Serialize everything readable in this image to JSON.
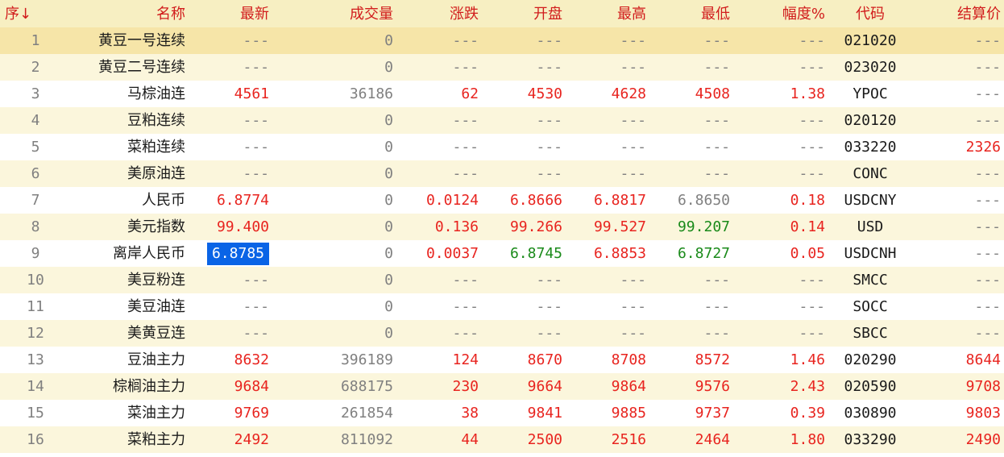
{
  "header": {
    "seq": "序",
    "seq_sort_icon": "arrow-down-icon",
    "sort_arrow": "↓",
    "name": "名称",
    "latest": "最新",
    "volume": "成交量",
    "change": "涨跌",
    "open": "开盘",
    "high": "最高",
    "low": "最低",
    "amplitude": "幅度%",
    "code": "代码",
    "settle": "结算价"
  },
  "colors": {
    "header_text": "#d11c1c",
    "up": "#e8241f",
    "down": "#1a8a1a",
    "neutral": "#808080",
    "selection": "#0a64e6"
  },
  "rows": [
    {
      "seq": "1",
      "name": "黄豆一号连续",
      "latest": "---",
      "volume": "0",
      "change": "---",
      "open": "---",
      "high": "---",
      "low": "---",
      "amplitude": "---",
      "code": "021020",
      "settle": "---"
    },
    {
      "seq": "2",
      "name": "黄豆二号连续",
      "latest": "---",
      "volume": "0",
      "change": "---",
      "open": "---",
      "high": "---",
      "low": "---",
      "amplitude": "---",
      "code": "023020",
      "settle": "---"
    },
    {
      "seq": "3",
      "name": "马棕油连",
      "latest": "4561",
      "volume": "36186",
      "change": "62",
      "open": "4530",
      "high": "4628",
      "low": "4508",
      "amplitude": "1.38",
      "code": "YPOC",
      "settle": "---"
    },
    {
      "seq": "4",
      "name": "豆粕连续",
      "latest": "---",
      "volume": "0",
      "change": "---",
      "open": "---",
      "high": "---",
      "low": "---",
      "amplitude": "---",
      "code": "020120",
      "settle": "---"
    },
    {
      "seq": "5",
      "name": "菜粕连续",
      "latest": "---",
      "volume": "0",
      "change": "---",
      "open": "---",
      "high": "---",
      "low": "---",
      "amplitude": "---",
      "code": "033220",
      "settle": "2326"
    },
    {
      "seq": "6",
      "name": "美原油连",
      "latest": "---",
      "volume": "0",
      "change": "---",
      "open": "---",
      "high": "---",
      "low": "---",
      "amplitude": "---",
      "code": "CONC",
      "settle": "---"
    },
    {
      "seq": "7",
      "name": "人民币",
      "latest": "6.8774",
      "volume": "0",
      "change": "0.0124",
      "open": "6.8666",
      "high": "6.8817",
      "low": "6.8650",
      "amplitude": "0.18",
      "code": "USDCNY",
      "settle": "---"
    },
    {
      "seq": "8",
      "name": "美元指数",
      "latest": "99.400",
      "volume": "0",
      "change": "0.136",
      "open": "99.266",
      "high": "99.527",
      "low": "99.207",
      "amplitude": "0.14",
      "code": "USD",
      "settle": "---"
    },
    {
      "seq": "9",
      "name": "离岸人民币",
      "latest": "6.8785",
      "volume": "0",
      "change": "0.0037",
      "open": "6.8745",
      "high": "6.8853",
      "low": "6.8727",
      "amplitude": "0.05",
      "code": "USDCNH",
      "settle": "---"
    },
    {
      "seq": "10",
      "name": "美豆粉连",
      "latest": "---",
      "volume": "0",
      "change": "---",
      "open": "---",
      "high": "---",
      "low": "---",
      "amplitude": "---",
      "code": "SMCC",
      "settle": "---"
    },
    {
      "seq": "11",
      "name": "美豆油连",
      "latest": "---",
      "volume": "0",
      "change": "---",
      "open": "---",
      "high": "---",
      "low": "---",
      "amplitude": "---",
      "code": "SOCC",
      "settle": "---"
    },
    {
      "seq": "12",
      "name": "美黄豆连",
      "latest": "---",
      "volume": "0",
      "change": "---",
      "open": "---",
      "high": "---",
      "low": "---",
      "amplitude": "---",
      "code": "SBCC",
      "settle": "---"
    },
    {
      "seq": "13",
      "name": "豆油主力",
      "latest": "8632",
      "volume": "396189",
      "change": "124",
      "open": "8670",
      "high": "8708",
      "low": "8572",
      "amplitude": "1.46",
      "code": "020290",
      "settle": "8644"
    },
    {
      "seq": "14",
      "name": "棕榈油主力",
      "latest": "9684",
      "volume": "688175",
      "change": "230",
      "open": "9664",
      "high": "9864",
      "low": "9576",
      "amplitude": "2.43",
      "code": "020590",
      "settle": "9708"
    },
    {
      "seq": "15",
      "name": "菜油主力",
      "latest": "9769",
      "volume": "261854",
      "change": "38",
      "open": "9841",
      "high": "9885",
      "low": "9737",
      "amplitude": "0.39",
      "code": "030890",
      "settle": "9803"
    },
    {
      "seq": "16",
      "name": "菜粕主力",
      "latest": "2492",
      "volume": "811092",
      "change": "44",
      "open": "2500",
      "high": "2516",
      "low": "2464",
      "amplitude": "1.80",
      "code": "033290",
      "settle": "2490"
    }
  ],
  "cell_colors": {
    "1": {
      "latest": "none",
      "change": "none",
      "open": "none",
      "high": "none",
      "low": "none",
      "amplitude": "none",
      "settle": "none"
    },
    "2": {
      "latest": "none",
      "change": "none",
      "open": "none",
      "high": "none",
      "low": "none",
      "amplitude": "none",
      "settle": "none"
    },
    "3": {
      "latest": "up",
      "change": "up",
      "open": "up",
      "high": "up",
      "low": "up",
      "amplitude": "up",
      "settle": "none"
    },
    "4": {
      "latest": "none",
      "change": "none",
      "open": "none",
      "high": "none",
      "low": "none",
      "amplitude": "none",
      "settle": "none"
    },
    "5": {
      "latest": "none",
      "change": "none",
      "open": "none",
      "high": "none",
      "low": "none",
      "amplitude": "none",
      "settle": "up"
    },
    "6": {
      "latest": "none",
      "change": "none",
      "open": "none",
      "high": "none",
      "low": "none",
      "amplitude": "none",
      "settle": "none"
    },
    "7": {
      "latest": "up",
      "change": "up",
      "open": "up",
      "high": "up",
      "low": "flat",
      "amplitude": "up",
      "settle": "none"
    },
    "8": {
      "latest": "up",
      "change": "up",
      "open": "up",
      "high": "up",
      "low": "down",
      "amplitude": "up",
      "settle": "none"
    },
    "9": {
      "latest": "up",
      "change": "up",
      "open": "down",
      "high": "up",
      "low": "down",
      "amplitude": "up",
      "settle": "none"
    },
    "10": {
      "latest": "none",
      "change": "none",
      "open": "none",
      "high": "none",
      "low": "none",
      "amplitude": "none",
      "settle": "none"
    },
    "11": {
      "latest": "none",
      "change": "none",
      "open": "none",
      "high": "none",
      "low": "none",
      "amplitude": "none",
      "settle": "none"
    },
    "12": {
      "latest": "none",
      "change": "none",
      "open": "none",
      "high": "none",
      "low": "none",
      "amplitude": "none",
      "settle": "none"
    },
    "13": {
      "latest": "up",
      "change": "up",
      "open": "up",
      "high": "up",
      "low": "up",
      "amplitude": "up",
      "settle": "up"
    },
    "14": {
      "latest": "up",
      "change": "up",
      "open": "up",
      "high": "up",
      "low": "up",
      "amplitude": "up",
      "settle": "up"
    },
    "15": {
      "latest": "up",
      "change": "up",
      "open": "up",
      "high": "up",
      "low": "up",
      "amplitude": "up",
      "settle": "up"
    },
    "16": {
      "latest": "up",
      "change": "up",
      "open": "up",
      "high": "up",
      "low": "up",
      "amplitude": "up",
      "settle": "up"
    }
  },
  "selected_row": "1",
  "highlighted_cell": {
    "row": "9",
    "column": "latest"
  }
}
